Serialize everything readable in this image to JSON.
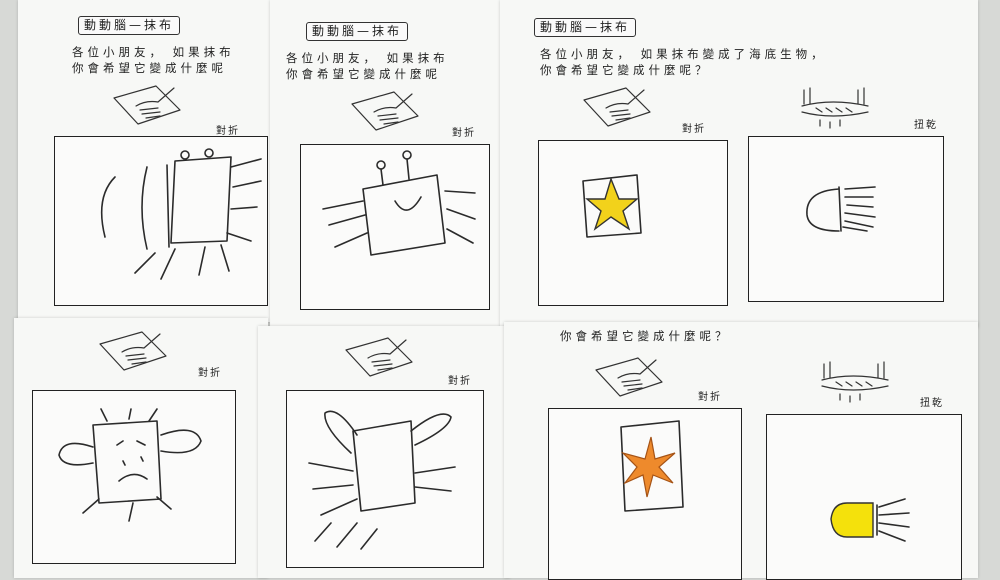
{
  "sheets": {
    "top_left": {
      "title": "動動腦—抹布",
      "line1": "各位小朋友，  如果抹布",
      "line2": "你會希望它變成什麼呢",
      "caption": "對折"
    },
    "top_mid": {
      "title": "動動腦—抹布",
      "line1": "各位小朋友，  如果抹布",
      "line2": "你會希望它變成什麼呢",
      "caption": "對折"
    },
    "top_right": {
      "title": "動動腦—抹布",
      "line1": "各位小朋友，  如果抹布變成了海底生物，",
      "line2": "你會希望它變成什麼呢？",
      "caption1": "對折",
      "caption2": "扭乾"
    },
    "bottom_left": {
      "caption": "對折"
    },
    "bottom_mid": {
      "caption": "對折"
    },
    "bottom_right": {
      "line2": "你會希望它變成什麼呢？",
      "caption1": "對折",
      "caption2": "扭乾"
    }
  },
  "colors": {
    "star_yellow": "#f2d21b",
    "star_orange": "#ee8a2c",
    "fish_yellow": "#f4e10c"
  },
  "icons": [
    "hand-on-cloth-icon",
    "wringing-hands-icon"
  ]
}
